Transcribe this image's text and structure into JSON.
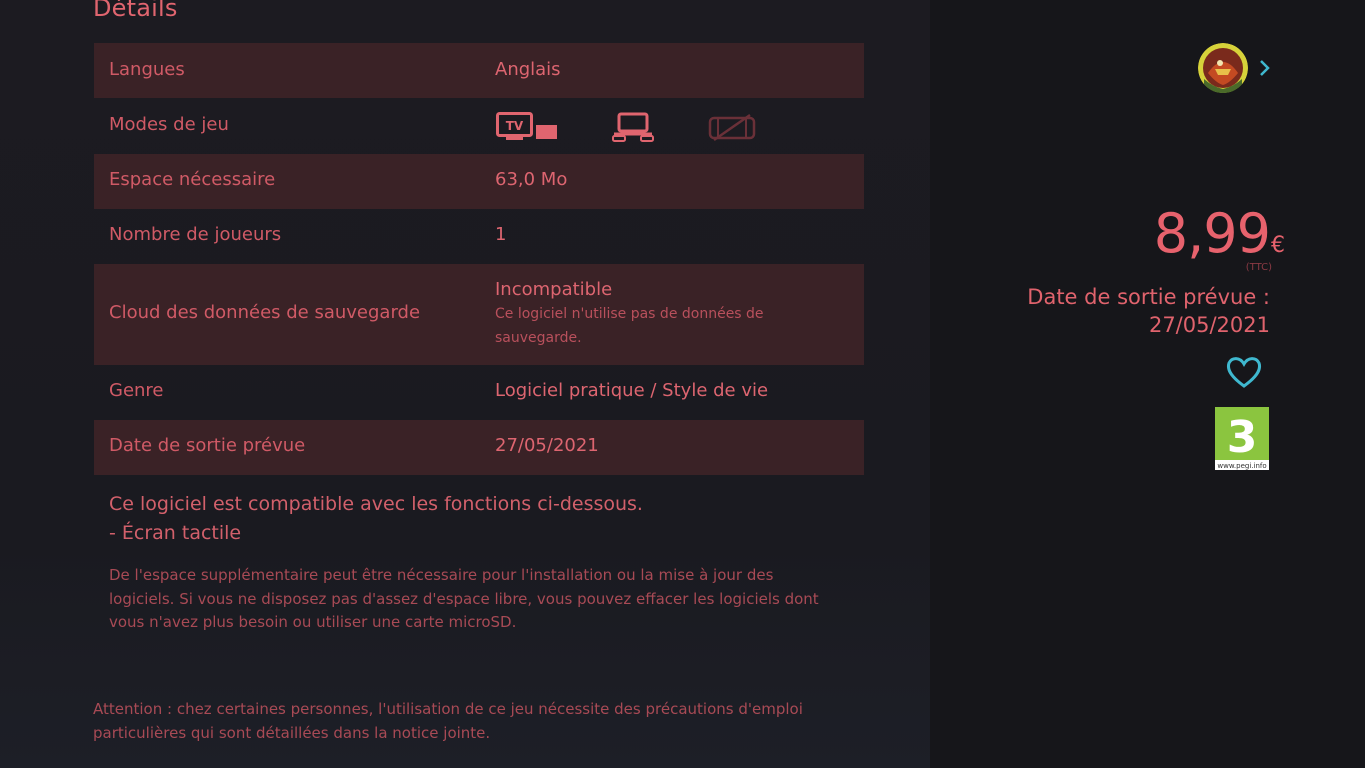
{
  "details": {
    "title": "Détails",
    "rows": [
      {
        "label": "Langues",
        "value": "Anglais"
      },
      {
        "label": "Modes de jeu",
        "value": ""
      },
      {
        "label": "Espace nécessaire",
        "value": "63,0 Mo"
      },
      {
        "label": "Nombre de joueurs",
        "value": "1"
      },
      {
        "label": "Cloud des données de sauvegarde",
        "value": "Incompatible",
        "sub": "Ce logiciel n'utilise pas de données de sauvegarde."
      },
      {
        "label": "Genre",
        "value": "Logiciel pratique / Style de vie"
      },
      {
        "label": "Date de sortie prévue",
        "value": "27/05/2021"
      }
    ],
    "play_modes": {
      "tv_mode_icon_text": "TV",
      "icons": [
        "tv-mode-icon",
        "tabletop-mode-icon",
        "handheld-mode-icon"
      ]
    }
  },
  "compat": {
    "line1": "Ce logiciel est compatible avec les fonctions ci-dessous.",
    "line2": "- Écran tactile"
  },
  "storage_note": "De l'espace supplémentaire peut être nécessaire pour l'installation ou la mise à jour des logiciels. Si vous ne disposez pas d'assez d'espace libre, vous pouvez effacer les logiciels dont vous n'avez plus besoin ou utiliser une carte microSD.",
  "attention": "Attention : chez certaines personnes, l'utilisation de ce jeu nécessite des précautions d'emploi particulières qui sont détaillées dans la notice jointe.",
  "sidebar": {
    "price": "8,99",
    "currency": "€",
    "tax_note": "(TTC)",
    "release_label": "Date de sortie prévue :",
    "release_date": "27/05/2021",
    "pegi_rating": "3",
    "pegi_site": "www.pegi.info",
    "icons": [
      "user-avatar",
      "chevron-right-icon",
      "heart-icon",
      "pegi-3-badge"
    ]
  },
  "colors": {
    "accent": "#e0656f",
    "row_shade": "#3a2226",
    "background": "#1b1b21",
    "teal": "#3fb8cf",
    "pegi_green": "#8bc53f"
  }
}
